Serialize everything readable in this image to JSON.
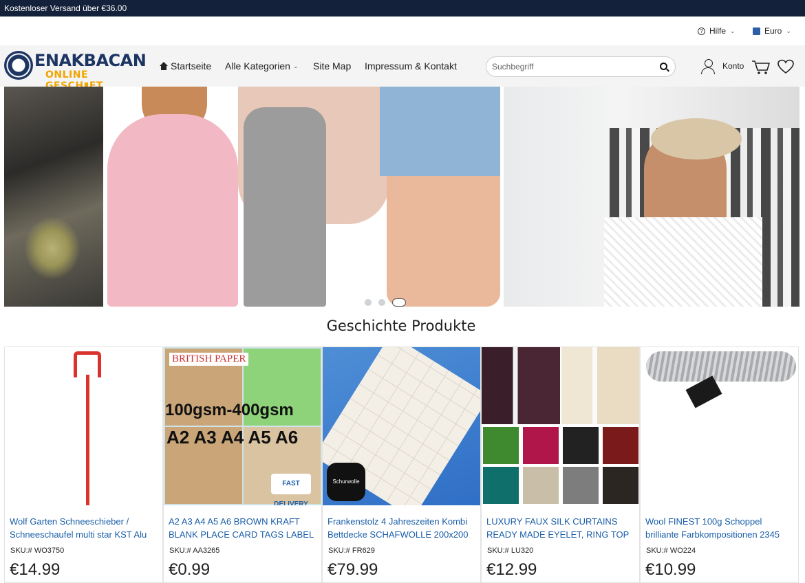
{
  "topbar": {
    "text": "Kostenloser Versand über €36.00"
  },
  "utility": {
    "help": "Hilfe",
    "currency": "Euro"
  },
  "logo": {
    "name": "ENAKBACAN",
    "subtitle": "ONLINE GESCH▮FT"
  },
  "nav": {
    "home": "Startseite",
    "categories": "Alle Kategorien",
    "sitemap": "Site Map",
    "imprint": "Impressum & Kontakt"
  },
  "search": {
    "placeholder": "Suchbegriff"
  },
  "account": {
    "label": "Konto"
  },
  "icons": [
    "question-icon",
    "flag-icon",
    "home-icon",
    "search-icon",
    "user-icon",
    "cart-icon",
    "heart-icon"
  ],
  "carousel": {
    "slide_count": 3,
    "active_index": 2
  },
  "section": {
    "title": "Geschichte Produkte"
  },
  "products": [
    {
      "name": "Wolf Garten Schneeschieber / Schneeschaufel multi star KST Alu",
      "sku": "SKU:# WO3750",
      "price": "€14.99"
    },
    {
      "name": "A2 A3 A4 A5 A6 BROWN KRAFT BLANK PLACE CARD TAGS LABEL",
      "sku": "SKU:# AA3265",
      "price": "€0.99",
      "image_text": {
        "brand": "BRITISH PAPER",
        "line1": "100gsm-400gsm",
        "line2": "A2 A3 A4 A5 A6",
        "badge": "FAST DELIVERY"
      }
    },
    {
      "name": "Frankenstolz 4 Jahreszeiten Kombi Bettdecke SCHAFWOLLE 200x200",
      "sku": "SKU:# FR629",
      "price": "€79.99",
      "image_text": {
        "badge": "Schurwolle"
      }
    },
    {
      "name": "LUXURY FAUX SILK CURTAINS READY MADE EYELET, RING TOP",
      "sku": "SKU:# LU320",
      "price": "€12.99"
    },
    {
      "name": "Wool FINEST 100g Schoppel brilliante Farbkompositionen 2345",
      "sku": "SKU:# WO224",
      "price": "€10.99"
    }
  ],
  "colors": {
    "topbar_bg": "#14213a",
    "header_bg": "#f4f4f4",
    "link": "#1a5ea8",
    "logo_blue": "#1d3563",
    "logo_orange": "#f0a500"
  }
}
